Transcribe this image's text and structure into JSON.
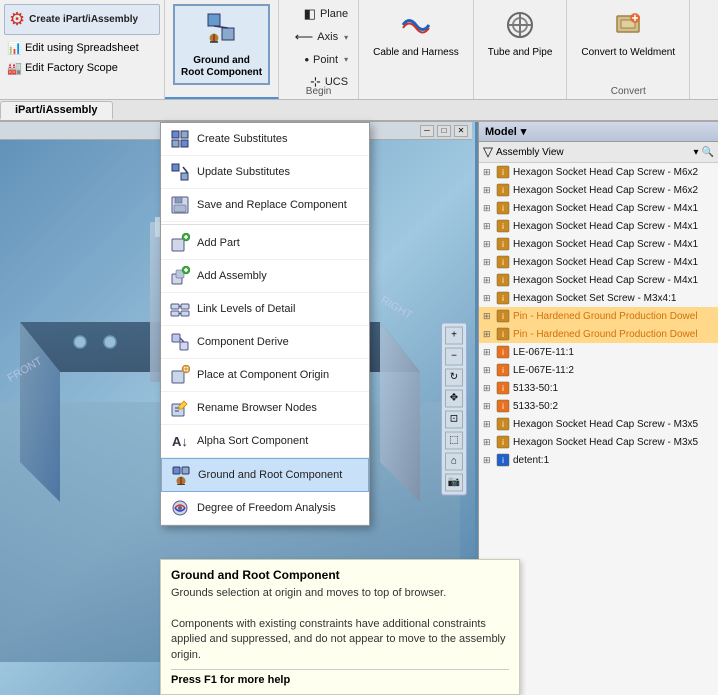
{
  "ribbon": {
    "left": {
      "create_ipart_label": "Create iPart/iAssembly",
      "spreadsheet_label": "Edit using Spreadsheet",
      "factory_label": "Edit Factory Scope",
      "tab_label": "iPart/iAssembly"
    },
    "sections": {
      "ground_and_root": {
        "label": "Ground and\nRoot Component",
        "sublabel": ""
      },
      "plane_label": "Plane",
      "axis_label": "Axis",
      "point_label": "Point",
      "ucs_label": "UCS",
      "begin_label": "Begin",
      "cable_harness_label": "Cable and\nHarness",
      "tube_pipe_label": "Tube and\nPipe",
      "convert_weldment_label": "Convert to\nWeldment",
      "convert_label": "Convert"
    }
  },
  "tab_row": {
    "active": "iPart/iAssembly"
  },
  "dropdown": {
    "items": [
      {
        "id": "create-substitutes",
        "label": "Create Substitutes",
        "icon": "⊞"
      },
      {
        "id": "update-substitutes",
        "label": "Update Substitutes",
        "icon": "⟳"
      },
      {
        "id": "save-replace",
        "label": "Save and Replace Component",
        "icon": "💾"
      },
      {
        "id": "add-part",
        "label": "Add Part",
        "icon": "+"
      },
      {
        "id": "add-assembly",
        "label": "Add Assembly",
        "icon": "+"
      },
      {
        "id": "link-levels",
        "label": "Link Levels of Detail",
        "icon": "🔗"
      },
      {
        "id": "component-derive",
        "label": "Component Derive",
        "icon": "⤷"
      },
      {
        "id": "place-component-origin",
        "label": "Place at Component Origin",
        "icon": "◎"
      },
      {
        "id": "rename-browser",
        "label": "Rename Browser Nodes",
        "icon": "✏"
      },
      {
        "id": "alpha-sort",
        "label": "Alpha Sort Component",
        "icon": "A↓"
      },
      {
        "id": "ground-root",
        "label": "Ground and Root Component",
        "icon": "⊕",
        "active": true
      },
      {
        "id": "degree-freedom",
        "label": "Degree of Freedom Analysis",
        "icon": "↔"
      }
    ]
  },
  "tooltip": {
    "title": "Ground and Root Component",
    "body": "Grounds selection at origin and moves to top of browser.\n\nComponents with existing constraints have additional constraints applied and suppressed, and do not appear to move to the assembly origin.",
    "hint": "Press F1 for more help"
  },
  "model_panel": {
    "title": "Model",
    "toolbar": {
      "filter_icon": "▽",
      "assembly_view_label": "Assembly View",
      "search_icon": "🔍"
    },
    "tree_items": [
      {
        "id": 1,
        "indent": 0,
        "expand": "⊞",
        "icon": "🔶",
        "label": "Hexagon Socket Head Cap Screw - M6x2",
        "highlight": false
      },
      {
        "id": 2,
        "indent": 0,
        "expand": "⊞",
        "icon": "🔶",
        "label": "Hexagon Socket Head Cap Screw - M6x2",
        "highlight": false
      },
      {
        "id": 3,
        "indent": 0,
        "expand": "⊞",
        "icon": "🔶",
        "label": "Hexagon Socket Head Cap Screw - M4x1",
        "highlight": false
      },
      {
        "id": 4,
        "indent": 0,
        "expand": "⊞",
        "icon": "🔶",
        "label": "Hexagon Socket Head Cap Screw - M4x1",
        "highlight": false
      },
      {
        "id": 5,
        "indent": 0,
        "expand": "⊞",
        "icon": "🔶",
        "label": "Hexagon Socket Head Cap Screw - M4x1",
        "highlight": false
      },
      {
        "id": 6,
        "indent": 0,
        "expand": "⊞",
        "icon": "🔶",
        "label": "Hexagon Socket Head Cap Screw - M4x1",
        "highlight": false
      },
      {
        "id": 7,
        "indent": 0,
        "expand": "⊞",
        "icon": "🔶",
        "label": "Hexagon Socket Head Cap Screw - M4x1",
        "highlight": false
      },
      {
        "id": 8,
        "indent": 0,
        "expand": "⊞",
        "icon": "🔶",
        "label": "Hexagon Socket Set Screw - M3x4:1",
        "highlight": false
      },
      {
        "id": 9,
        "indent": 0,
        "expand": "⊞",
        "icon": "🔶",
        "label": "Pin - Hardened Ground Production Dowel",
        "highlight": true
      },
      {
        "id": 10,
        "indent": 0,
        "expand": "⊞",
        "icon": "🔶",
        "label": "Pin - Hardened Ground Production Dowel",
        "highlight": true
      },
      {
        "id": 11,
        "indent": 0,
        "expand": "⊞",
        "icon": "🟧",
        "label": "LE-067E-11:1",
        "highlight": false
      },
      {
        "id": 12,
        "indent": 0,
        "expand": "⊞",
        "icon": "🟧",
        "label": "LE-067E-11:2",
        "highlight": false
      },
      {
        "id": 13,
        "indent": 0,
        "expand": "⊞",
        "icon": "🟧",
        "label": "5133-50:1",
        "highlight": false
      },
      {
        "id": 14,
        "indent": 0,
        "expand": "⊞",
        "icon": "🟧",
        "label": "5133-50:2",
        "highlight": false
      },
      {
        "id": 15,
        "indent": 0,
        "expand": "⊞",
        "icon": "🔶",
        "label": "Hexagon Socket Head Cap Screw - M3x5",
        "highlight": false
      },
      {
        "id": 16,
        "indent": 0,
        "expand": "⊞",
        "icon": "🔶",
        "label": "Hexagon Socket Head Cap Screw - M3x5",
        "highlight": false
      },
      {
        "id": 17,
        "indent": 0,
        "expand": "⊞",
        "icon": "🔵",
        "label": "detent:1",
        "highlight": false
      }
    ]
  },
  "colors": {
    "accent_blue": "#2060c0",
    "highlight_orange": "#e87020",
    "tooltip_bg": "#fffff0",
    "ribbon_bg": "#f0f0f0",
    "active_menu_bg": "#c8e0f8",
    "tree_highlight": "#d4700a"
  }
}
